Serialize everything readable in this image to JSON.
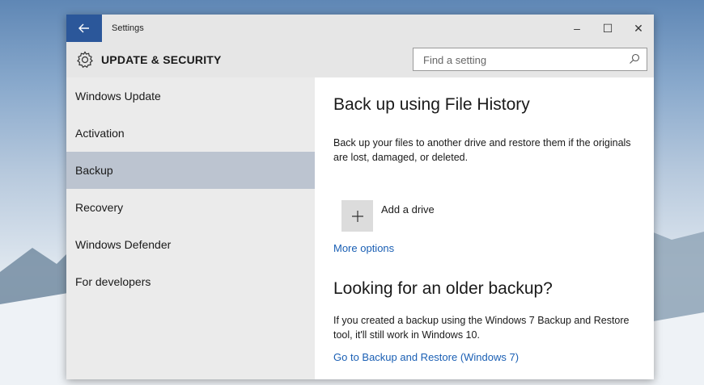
{
  "window": {
    "title": "Settings",
    "controls": {
      "minimize": "–",
      "maximize": "☐",
      "close": "✕"
    }
  },
  "header": {
    "section_title": "UPDATE & SECURITY",
    "search_placeholder": "Find a setting"
  },
  "sidebar": {
    "items": [
      {
        "label": "Windows Update"
      },
      {
        "label": "Activation"
      },
      {
        "label": "Backup",
        "selected": true
      },
      {
        "label": "Recovery"
      },
      {
        "label": "Windows Defender"
      },
      {
        "label": "For developers"
      }
    ]
  },
  "main": {
    "backup_heading": "Back up using File History",
    "backup_description": "Back up your files to another drive and restore them if the originals are lost, damaged, or deleted.",
    "add_drive_label": "Add a drive",
    "more_options_link": "More options",
    "older_backup_heading": "Looking for an older backup?",
    "older_backup_description": "If you created a backup using the Windows 7 Backup and Restore tool, it'll still work in Windows 10.",
    "restore_link": "Go to Backup and Restore (Windows 7)"
  },
  "icons": {
    "back": "back-arrow-icon",
    "gear": "gear-icon",
    "search": "search-icon",
    "add": "plus-icon"
  },
  "colors": {
    "accent": "#2b579a",
    "selected_item": "#bcc4d0",
    "link": "#1a5fb4"
  }
}
